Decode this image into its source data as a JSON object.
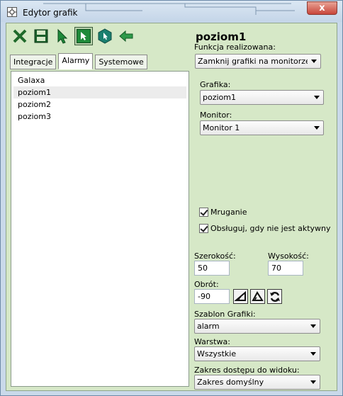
{
  "window": {
    "title": "Edytor grafik",
    "close_label": "x"
  },
  "toolbar": {
    "buttons": [
      {
        "name": "close-x-icon",
        "pressed": false
      },
      {
        "name": "save-icon",
        "pressed": false
      },
      {
        "name": "arrow-cursor-icon",
        "pressed": false
      },
      {
        "name": "selection-cursor-icon",
        "pressed": true
      },
      {
        "name": "polygon-icon",
        "pressed": false
      },
      {
        "name": "back-arrow-icon",
        "pressed": false
      }
    ]
  },
  "tabs": [
    "Integracje",
    "Alarmy",
    "Systemowe"
  ],
  "active_tab": "Alarmy",
  "list": {
    "items": [
      "Galaxa",
      "poziom1",
      "poziom2",
      "poziom3"
    ],
    "selected": "poziom1"
  },
  "detail": {
    "heading": "poziom1",
    "function_label": "Funkcja realizowana:",
    "function_value": "Zamknij grafiki na monitorze i otw",
    "graphic_label": "Grafika:",
    "graphic_value": "poziom1",
    "monitor_label": "Monitor:",
    "monitor_value": "Monitor 1",
    "blink_label": "Mruganie",
    "handle_inactive_label": "Obsługuj, gdy nie jest aktywny",
    "width_label": "Szerokość:",
    "width_value": "50",
    "height_label": "Wysokość:",
    "height_value": "70",
    "rotation_label": "Obrót:",
    "rotation_value": "-90",
    "template_label": "Szablon Grafiki:",
    "template_value": "alarm",
    "layer_label": "Warstwa:",
    "layer_value": "Wszystkie",
    "access_label": "Zakres dostępu do widoku:",
    "access_value": "Zakres domyślny"
  },
  "colors": {
    "panel": "#d6e8c7",
    "accent_green": "#2e8b3a",
    "teal": "#1a7f6f"
  }
}
